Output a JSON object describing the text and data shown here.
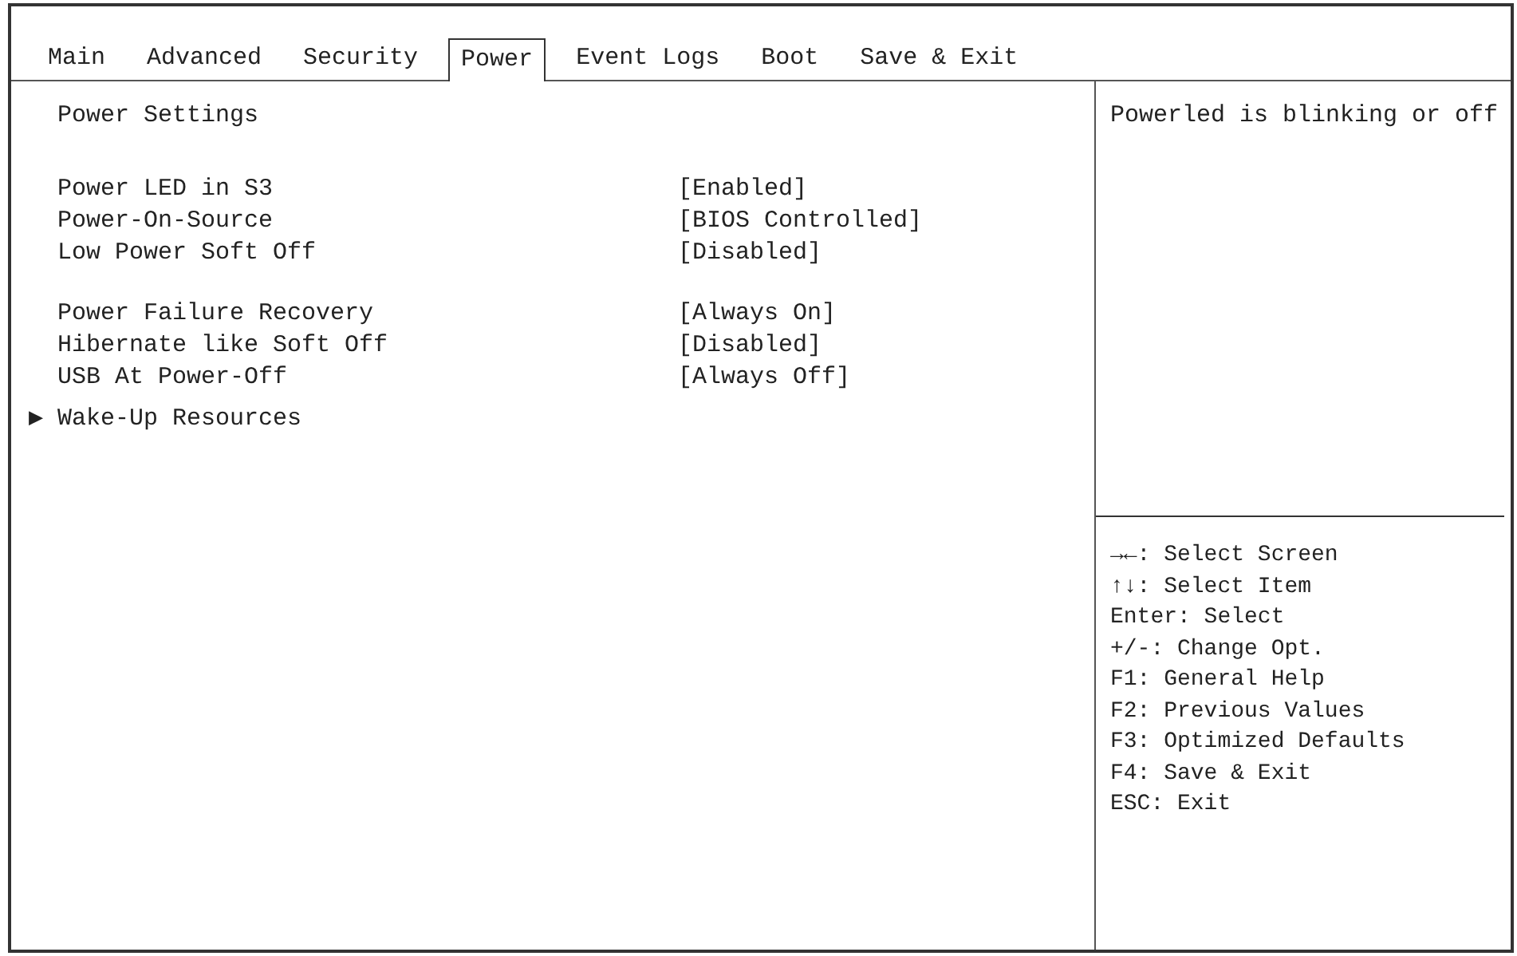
{
  "tabs": [
    {
      "label": "Main",
      "selected": false
    },
    {
      "label": "Advanced",
      "selected": false
    },
    {
      "label": "Security",
      "selected": false
    },
    {
      "label": "Power",
      "selected": true
    },
    {
      "label": "Event Logs",
      "selected": false
    },
    {
      "label": "Boot",
      "selected": false
    },
    {
      "label": "Save & Exit",
      "selected": false
    }
  ],
  "heading": "Power Settings",
  "groups": [
    {
      "items": [
        {
          "kind": "setting",
          "label": "Power LED in S3",
          "value": "[Enabled]"
        },
        {
          "kind": "setting",
          "label": "Power-On-Source",
          "value": "[BIOS Controlled]"
        },
        {
          "kind": "setting",
          "label": "Low Power Soft Off",
          "value": "[Disabled]"
        }
      ]
    },
    {
      "items": [
        {
          "kind": "setting",
          "label": "Power Failure Recovery",
          "value": "[Always On]"
        },
        {
          "kind": "setting",
          "label": "Hibernate like Soft Off",
          "value": "[Disabled]"
        },
        {
          "kind": "setting",
          "label": "USB At Power-Off",
          "value": "[Always Off]"
        },
        {
          "kind": "submenu",
          "marker": "▶",
          "label": "Wake-Up Resources"
        }
      ]
    }
  ],
  "help_text": "Powerled is blinking or off",
  "key_hints": [
    "→←: Select Screen",
    "↑↓: Select Item",
    "Enter: Select",
    "+/-: Change Opt.",
    "F1: General Help",
    "F2: Previous Values",
    "F3: Optimized Defaults",
    "F4: Save & Exit",
    "ESC: Exit"
  ]
}
